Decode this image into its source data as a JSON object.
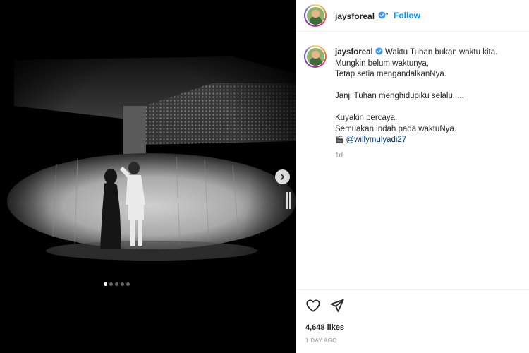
{
  "post": {
    "username": "jaysforeal",
    "separator": "•",
    "follow_label": "Follow",
    "caption_lines": [
      "Waktu Tuhan bukan waktu kita.",
      "Mungkin belum waktunya,",
      "Tetap setia mengandalkanNya."
    ],
    "caption_paragraph2": "Janji Tuhan menghidupiku selalu.....",
    "caption_lines3": [
      "Kuyakin percaya.",
      "Semuakan indah pada waktuNya."
    ],
    "clapper_emoji": "🎬",
    "mention": "@willymulyadi27",
    "relative_time": "1d",
    "likes": "4,648 likes",
    "date": "1 DAY AGO"
  },
  "carousel": {
    "slide_count": 5,
    "active_index": 0
  },
  "icons": {
    "verified": "verified-badge-icon",
    "next": "chevron-right-icon",
    "like": "heart-icon",
    "share": "paper-plane-icon"
  },
  "colors": {
    "accent": "#0095f6",
    "verified": "#3897f0",
    "muted": "#8e8e8e",
    "text": "#262626",
    "mention": "#00376b"
  }
}
